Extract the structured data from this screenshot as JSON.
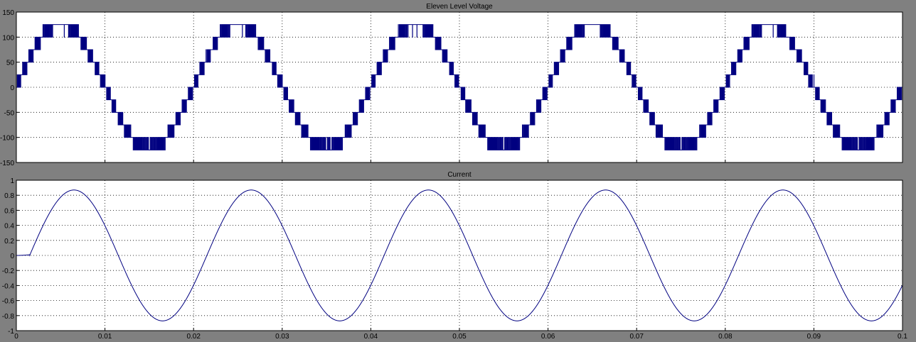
{
  "chart_data": [
    {
      "type": "line",
      "title": "Eleven Level Voltage",
      "xlabel": "",
      "ylabel": "",
      "xlim": [
        0,
        0.1
      ],
      "ylim": [
        -150,
        150
      ],
      "grid": true,
      "xticks": [
        "0",
        "0.01",
        "0.02",
        "0.03",
        "0.04",
        "0.05",
        "0.06",
        "0.07",
        "0.08",
        "0.09",
        "0.1"
      ],
      "yticks": [
        "150",
        "100",
        "50",
        "0",
        "-50",
        "-100",
        "-150"
      ],
      "show_x_tick_labels": false,
      "series": [
        {
          "color": "#000080",
          "waveform": "stepped-pwm",
          "frequency_hz": 50,
          "levels": [
            -125,
            -100,
            -75,
            -50,
            -25,
            0,
            25,
            50,
            75,
            100,
            125
          ],
          "peak": 125,
          "x": [
            0,
            0.001,
            0.0025,
            0.005,
            0.0075,
            0.009,
            0.01,
            0.011,
            0.0125,
            0.015,
            0.0175,
            0.019,
            0.02
          ],
          "values": [
            0,
            25,
            75,
            112,
            75,
            25,
            0,
            -25,
            -75,
            -112,
            -75,
            -25,
            0
          ]
        }
      ]
    },
    {
      "type": "line",
      "title": "Current",
      "xlabel": "",
      "ylabel": "",
      "xlim": [
        0,
        0.1
      ],
      "ylim": [
        -1,
        1
      ],
      "grid": true,
      "xticks": [
        "0",
        "0.01",
        "0.02",
        "0.03",
        "0.04",
        "0.05",
        "0.06",
        "0.07",
        "0.08",
        "0.09",
        "0.1"
      ],
      "yticks": [
        "1",
        "0.8",
        "0.6",
        "0.4",
        "0.2",
        "0",
        "-0.2",
        "-0.4",
        "-0.6",
        "-0.8",
        "-1"
      ],
      "show_x_tick_labels": true,
      "series": [
        {
          "color": "#000080",
          "waveform": "sine",
          "frequency_hz": 50,
          "amplitude": 0.87,
          "x": [
            0,
            0.0065,
            0.0165,
            0.0265,
            0.0365,
            0.0465,
            0.0565,
            0.0665,
            0.0765,
            0.0865,
            0.0965,
            0.1
          ],
          "values": [
            0,
            0.87,
            -0.87,
            0.87,
            -0.87,
            0.87,
            -0.87,
            0.87,
            -0.87,
            0.87,
            -0.87,
            -0.4
          ]
        }
      ]
    }
  ]
}
